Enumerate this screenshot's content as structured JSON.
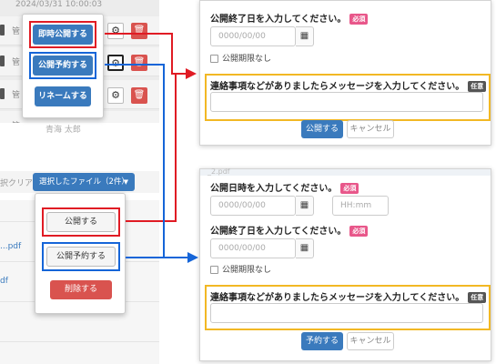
{
  "top_list": {
    "date_text": "2024/03/31 10:00:03",
    "row_texts": [
      "管",
      "管",
      "管",
      "管"
    ],
    "under_dropdown_text": "青海 太郎"
  },
  "row_menu": {
    "publish_now": "即時公開する",
    "schedule_publish": "公開予約する",
    "rename": "リネームする"
  },
  "bulk": {
    "clear_label": "択クリア",
    "selected_button": "選択したファイル（2件）",
    "files": [
      "...pdf",
      "df"
    ],
    "menu": {
      "publish": "公開する",
      "schedule": "公開予約する",
      "delete": "削除する"
    }
  },
  "modal_publish": {
    "end_date_label": "公開終了日を入力してください。",
    "required_badge": "必須",
    "date_placeholder": "0000/00/00",
    "no_limit_label": "公開期限なし",
    "message_label": "連絡事項などがありましたらメッセージを入力してください。",
    "optional_badge": "任意",
    "submit": "公開する",
    "cancel": "キャンセル"
  },
  "modal_schedule": {
    "partial_filename": "_2.pdf",
    "start_label": "公開日時を入力してください。",
    "required_badge": "必須",
    "date_placeholder": "0000/00/00",
    "time_placeholder": "HH:mm",
    "end_date_label": "公開終了日を入力してください。",
    "no_limit_label": "公開期限なし",
    "message_label": "連絡事項などがありましたらメッセージを入力してください。",
    "optional_badge": "任意",
    "submit": "予約する",
    "cancel": "キャンセル"
  },
  "colors": {
    "primary": "#3a7abd",
    "danger": "#d9534f",
    "highlight_red": "#e01b24",
    "highlight_blue": "#1565d8",
    "highlight_yellow": "#f2b824",
    "required_badge": "#e8578a"
  },
  "icons": {
    "settings": "gear-icon",
    "delete": "trash-icon",
    "calendar": "calendar-icon",
    "caret": "caret-down-icon"
  }
}
